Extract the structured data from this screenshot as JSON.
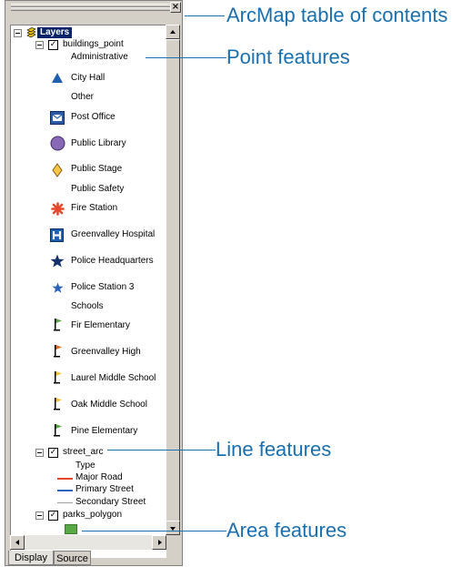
{
  "toc": {
    "close_glyph": "×",
    "root_label": "Layers",
    "layers": [
      {
        "name": "buildings_point",
        "expand": "−",
        "checked": "✓"
      },
      {
        "name": "street_arc",
        "expand": "−",
        "checked": "✓"
      },
      {
        "name": "parks_polygon",
        "expand": "−",
        "checked": "✓"
      }
    ],
    "building_groups": {
      "administrative": "Administrative",
      "other": "Other",
      "public_safety": "Public Safety",
      "schools": "Schools"
    },
    "building_items": {
      "city_hall": "City Hall",
      "post_office": "Post Office",
      "public_library": "Public Library",
      "public_stage": "Public Stage",
      "fire_station": "Fire Station",
      "greenvalley_hospital": "Greenvalley Hospital",
      "police_headquarters": "Police Headquarters",
      "police_station_3": "Police Station 3",
      "fir_elementary": "Fir Elementary",
      "greenvalley_high": "Greenvalley High",
      "laurel_middle_school": "Laurel Middle School",
      "oak_middle_school": "Oak Middle School",
      "pine_elementary": "Pine Elementary"
    },
    "street": {
      "type_heading": "Type",
      "major_road": "Major Road",
      "primary_street": "Primary Street",
      "secondary_street": "Secondary Street"
    },
    "tabs": {
      "display": "Display",
      "source": "Source"
    }
  },
  "callouts": {
    "toc": "ArcMap table of contents",
    "point": "Point features",
    "line": "Line features",
    "area": "Area features"
  },
  "colors": {
    "callout": "#1a6fae",
    "major_road": "#e8462a",
    "primary_street": "#2a63b8",
    "secondary_street": "#a0a0a0",
    "park_fill": "#5aa845",
    "selection": "#0a246a"
  },
  "icons": {
    "city_hall": "triangle-icon",
    "post_office": "post-office-icon",
    "public_library": "circle-icon",
    "public_stage": "diamond-icon",
    "fire_station": "asterisk-icon",
    "hospital": "hospital-icon",
    "police": "star-icon",
    "school": "school-flag-icon"
  }
}
